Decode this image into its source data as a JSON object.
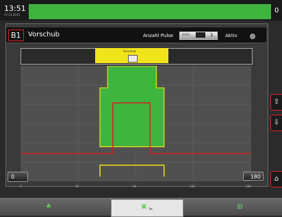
{
  "status": {
    "time": "13:51",
    "date": "17.11.2015",
    "top_right_value": "0"
  },
  "panel": {
    "badge": "B1",
    "title": "Vorschub",
    "pulse_label": "Anzahl Pulse",
    "pulse_unit": "min.",
    "pulse_value": "1",
    "active_label": "Aktiv"
  },
  "timeline": {
    "label": "Vorschub",
    "icon": "device-icon"
  },
  "chart_data": {
    "type": "line",
    "x_ticks": [
      "0",
      "45",
      "90",
      "135",
      "180"
    ],
    "xlim": [
      0,
      180
    ],
    "grid": true,
    "series": [
      {
        "color": "#f2e41a",
        "points": [
          [
            62,
            0.04
          ],
          [
            62,
            0.14
          ],
          [
            112,
            0.14
          ],
          [
            112,
            0.04
          ]
        ]
      },
      {
        "color": "#3fb43f",
        "points": [
          [
            62,
            0.3
          ],
          [
            62,
            0.81
          ],
          [
            68,
            0.81
          ],
          [
            68,
            1.0
          ],
          [
            106,
            1.0
          ],
          [
            106,
            0.81
          ],
          [
            112,
            0.81
          ],
          [
            112,
            0.3
          ]
        ]
      },
      {
        "color": "#d22222",
        "points": [
          [
            0,
            0.24
          ],
          [
            72,
            0.24
          ],
          [
            72,
            0.68
          ],
          [
            101,
            0.68
          ],
          [
            101,
            0.24
          ],
          [
            180,
            0.24
          ]
        ]
      }
    ]
  },
  "controls": {
    "left_value": "0",
    "right_value": "180",
    "up_icon": "arrow-up-icon",
    "down_icon": "arrow-down-icon",
    "home_icon": "home-icon"
  },
  "bottom": {
    "active_label": "In"
  },
  "colors": {
    "green": "#3fb43f",
    "yellow": "#f2e41a",
    "red": "#d22222"
  }
}
